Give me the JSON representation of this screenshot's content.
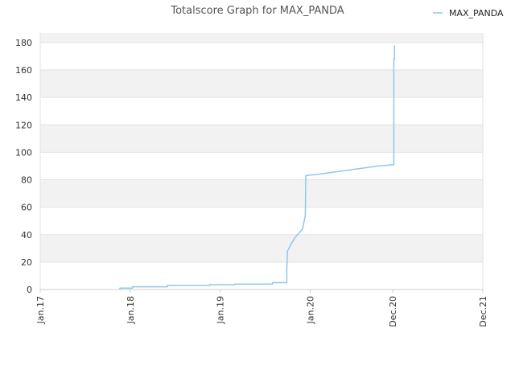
{
  "chart_data": {
    "type": "line",
    "title": "Totalscore Graph for MAX_PANDA",
    "xlabel": "",
    "ylabel": "",
    "x_ticks": [
      "Jan.17",
      "Jan.18",
      "Jan.19",
      "Jan.20",
      "Dec.20",
      "Dec.21"
    ],
    "x_tick_dates": [
      "2017-01-01",
      "2018-01-01",
      "2019-01-01",
      "2020-01-01",
      "2020-12-01",
      "2021-12-01"
    ],
    "ylim": [
      0,
      187
    ],
    "y_ticks": [
      0,
      20,
      40,
      60,
      80,
      100,
      120,
      140,
      160,
      180
    ],
    "grid": true,
    "legend_position": "top-right",
    "series": [
      {
        "name": "MAX_PANDA",
        "color": "#8ec8ee",
        "points": [
          [
            "2017-11-20",
            0
          ],
          [
            "2017-11-20",
            1
          ],
          [
            "2018-01-10",
            1
          ],
          [
            "2018-01-10",
            2
          ],
          [
            "2018-06-01",
            2
          ],
          [
            "2018-06-01",
            3
          ],
          [
            "2018-11-20",
            3
          ],
          [
            "2018-11-20",
            3.5
          ],
          [
            "2019-03-01",
            3.5
          ],
          [
            "2019-03-01",
            4
          ],
          [
            "2019-08-01",
            4
          ],
          [
            "2019-08-01",
            5
          ],
          [
            "2019-09-28",
            5
          ],
          [
            "2019-09-28",
            14
          ],
          [
            "2019-10-01",
            28
          ],
          [
            "2019-10-15",
            33
          ],
          [
            "2019-11-01",
            38
          ],
          [
            "2019-12-01",
            44
          ],
          [
            "2019-12-12",
            54
          ],
          [
            "2019-12-14",
            83
          ],
          [
            "2020-02-01",
            84
          ],
          [
            "2020-06-01",
            87
          ],
          [
            "2020-10-01",
            90
          ],
          [
            "2020-12-05",
            91
          ],
          [
            "2020-12-05",
            168
          ],
          [
            "2020-12-08",
            168
          ],
          [
            "2020-12-08",
            178
          ]
        ]
      }
    ]
  }
}
